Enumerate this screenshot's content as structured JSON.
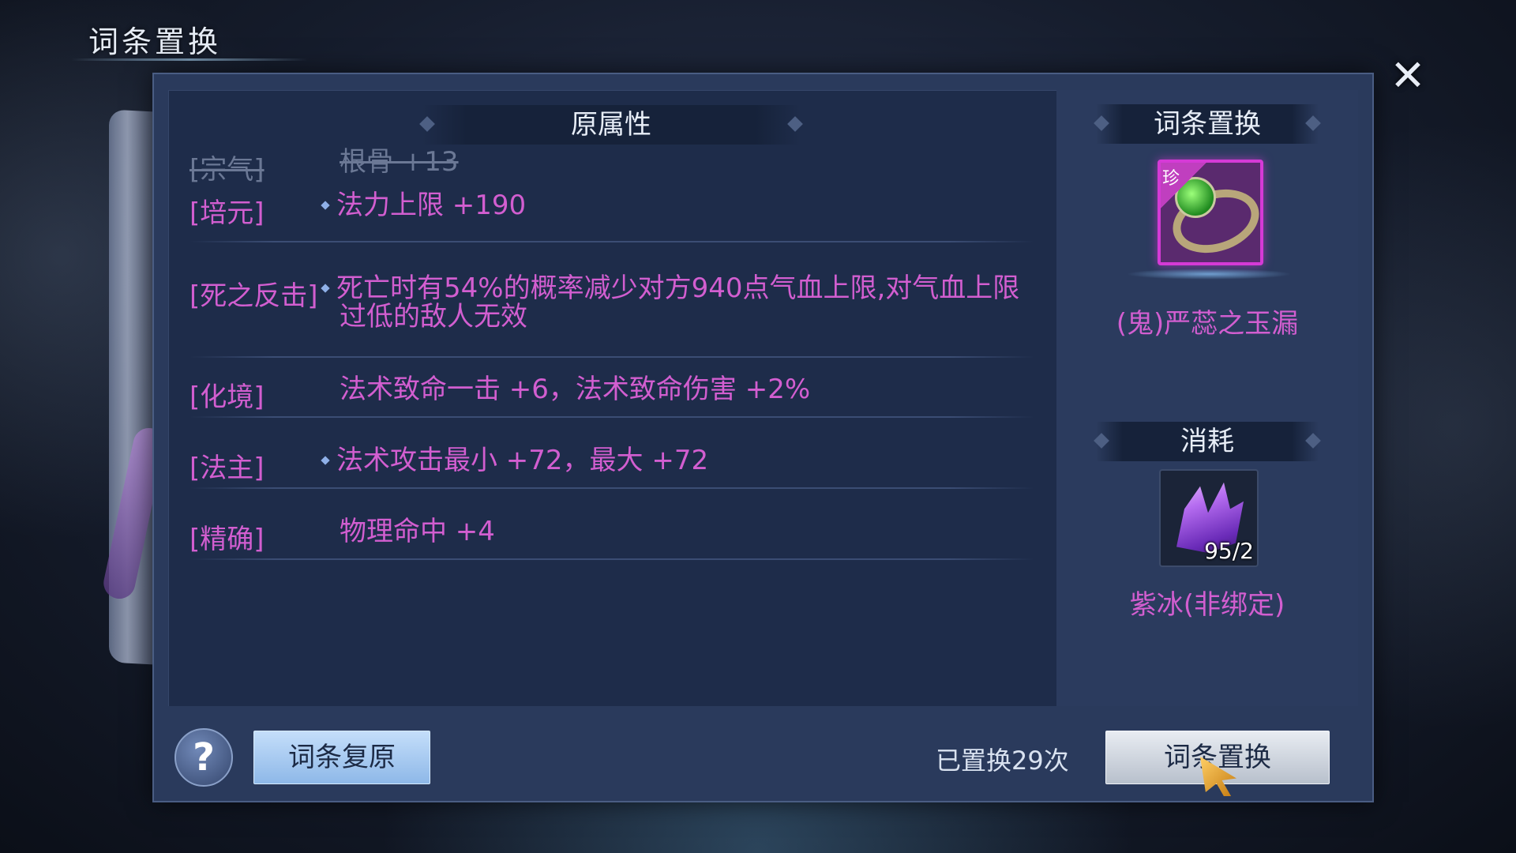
{
  "window": {
    "title": "词条置换",
    "close_icon": "close-x-icon"
  },
  "left_panel": {
    "header": "原属性",
    "attributes": [
      {
        "name": "[宗气]",
        "value": "根骨 +13",
        "struck": true,
        "diamond": false
      },
      {
        "name": "[培元]",
        "value": "法力上限 +190",
        "struck": false,
        "diamond": true
      },
      {
        "name": "[死之反击]",
        "value": "死亡时有54%的概率减少对方940点气血上限,对气血上限过低的敌人无效",
        "struck": false,
        "diamond": true
      },
      {
        "name": "[化境]",
        "value": "法术致命一击 +6，法术致命伤害 +2%",
        "struck": false,
        "diamond": false
      },
      {
        "name": "[法主]",
        "value": "法术攻击最小 +72，最大 +72",
        "struck": false,
        "diamond": true
      },
      {
        "name": "[精确]",
        "value": "物理命中 +4",
        "struck": false,
        "diamond": false
      }
    ]
  },
  "right_panel": {
    "header": "词条置换",
    "item": {
      "name": "(鬼)严蕊之玉漏",
      "rarity": "珍",
      "icon": "green-gem-ring-icon"
    },
    "cost_header": "消耗",
    "cost_item": {
      "name": "紫冰(非绑定)",
      "count": "95/2",
      "icon": "purple-crystal-icon"
    }
  },
  "bottom_bar": {
    "help_label": "?",
    "restore_label": "词条复原",
    "replaced_count": "已置换29次",
    "replace_label": "词条置换"
  },
  "colors": {
    "attribute": "#d25ed0",
    "struck": "#6b7895",
    "panel": "#2a3a5c",
    "rarity_border": "#d53ad6"
  }
}
